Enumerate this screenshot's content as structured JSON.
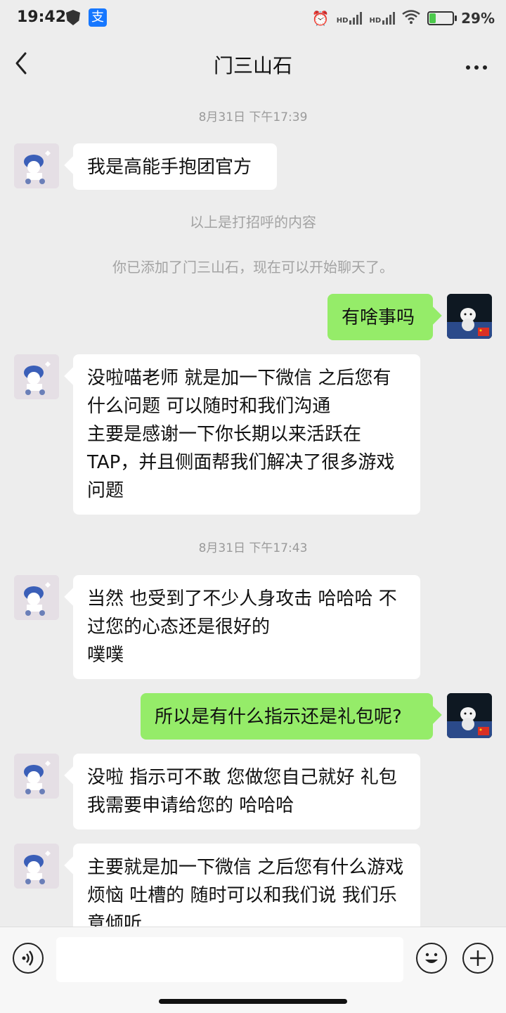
{
  "status": {
    "time": "19:42",
    "app_icon": "支",
    "signal1": "HD",
    "signal2": "HD",
    "battery": "29%",
    "battery_level": 0.29
  },
  "header": {
    "title": "门三山石",
    "back_icon": "chevron-left-icon",
    "more_icon": "more-dots-icon"
  },
  "chat": {
    "timestamp1": "8月31日 下午17:39",
    "msg1": "我是高能手抱团官方",
    "sys1": "以上是打招呼的内容",
    "sys2": "你已添加了门三山石，现在可以开始聊天了。",
    "msg2": "有啥事吗",
    "msg3": "没啦喵老师 就是加一下微信 之后您有什么问题 可以随时和我们沟通\n主要是感谢一下你长期以来活跃在TAP，并且侧面帮我们解决了很多游戏问题",
    "timestamp2": "8月31日 下午17:43",
    "msg4": "当然 也受到了不少人身攻击 哈哈哈 不过您的心态还是很好的\n噗噗",
    "msg5": "所以是有什么指示还是礼包呢?",
    "msg6": "没啦 指示可不敢 您做您自己就好 礼包我需要申请给您的 哈哈哈",
    "msg7": "主要就是加一下微信 之后您有什么游戏烦恼 吐槽的 随时可以和我们说 我们乐意倾听"
  },
  "input": {
    "voice_icon": "voice-icon",
    "emoji_icon": "emoji-icon",
    "plus_icon": "plus-icon"
  },
  "colors": {
    "background": "#ededed",
    "bubble_self": "#95ec69",
    "bubble_other": "#ffffff"
  }
}
